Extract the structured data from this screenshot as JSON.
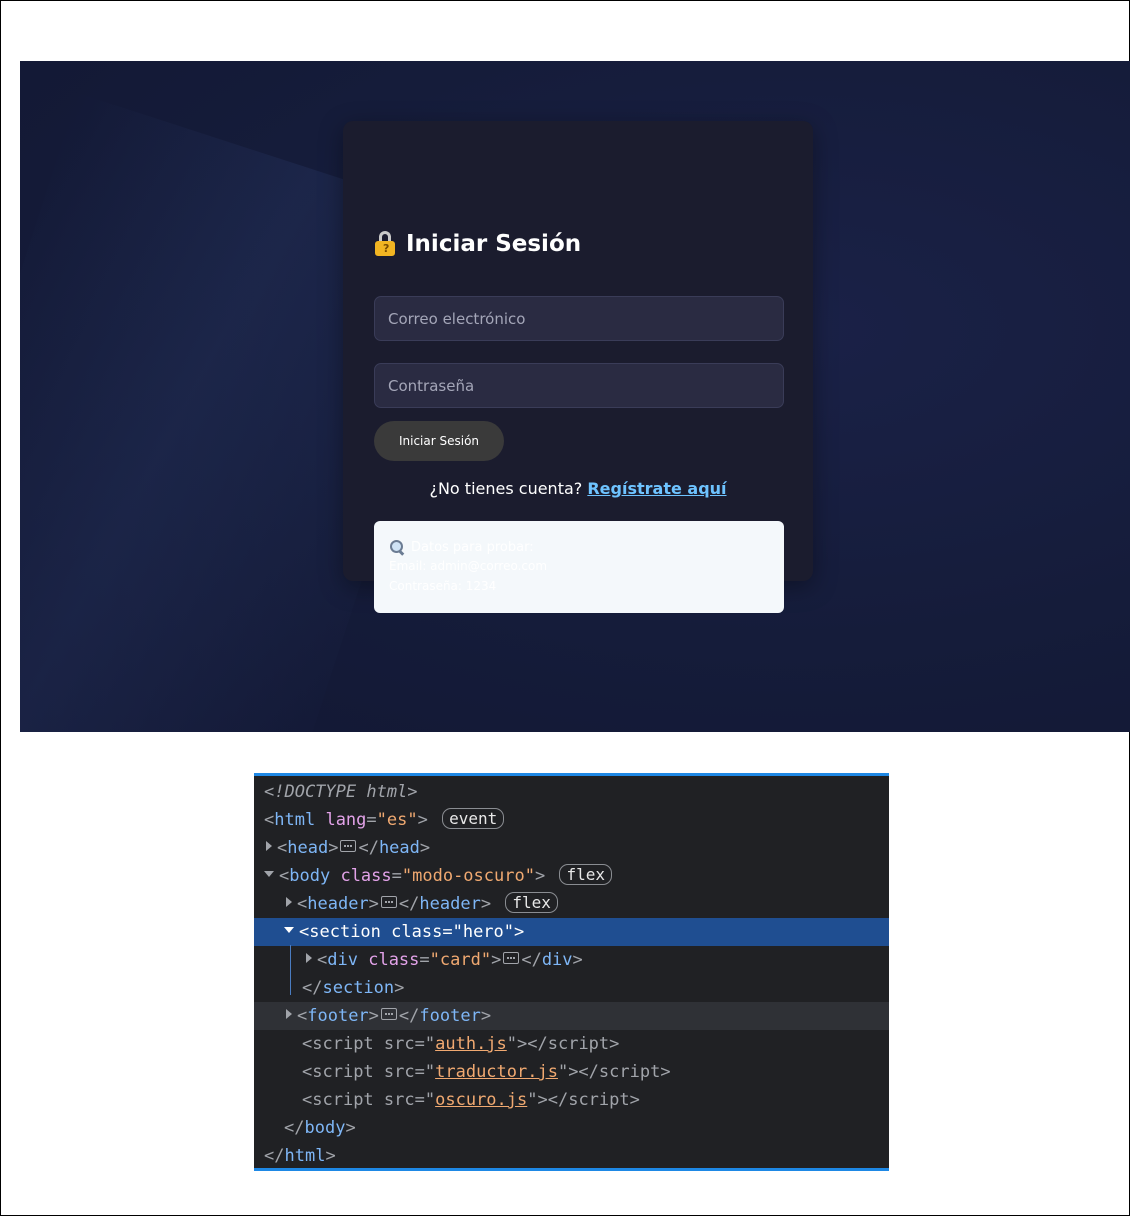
{
  "login": {
    "title": "Iniciar Sesión",
    "title_icon": "locked-with-key-icon",
    "email_placeholder": "Correo electrónico",
    "password_placeholder": "Contraseña",
    "submit_label": "Iniciar Sesión",
    "register_prompt": "¿No tienes cuenta?",
    "register_link": "Regístrate aquí",
    "info_box": {
      "icon": "magnifier-icon",
      "line1": "Datos para probar:",
      "line2": "Email: admin@correo.com",
      "line3": "Contraseña: 1234"
    },
    "colors": {
      "background": "#151c3a",
      "card": "#1b1c2e",
      "field": "#2a2b42",
      "button": "#3a3a3a",
      "link": "#6ec3ff",
      "info_box": "#f4f8fb"
    }
  },
  "devtools": {
    "accent": "#1e88e5",
    "lines": {
      "doctype": "<!DOCTYPE html>",
      "html_tag": "html",
      "html_attr": "lang",
      "html_val": "\"es\"",
      "html_badge": "event",
      "head_tag": "head",
      "body_tag": "body",
      "body_attr": "class",
      "body_val": "\"modo-oscuro\"",
      "body_badge": "flex",
      "header_tag": "header",
      "header_badge": "flex",
      "section_tag": "section",
      "section_attr": "class",
      "section_val": "\"hero\"",
      "div_tag": "div",
      "div_attr": "class",
      "div_val": "\"card\"",
      "section_close": "section",
      "footer_tag": "footer",
      "script_tag": "script",
      "script_attr": "src",
      "script1_src": "auth.js",
      "script2_src": "traductor.js",
      "script3_src": "oscuro.js",
      "body_close": "body",
      "html_close": "html"
    }
  }
}
